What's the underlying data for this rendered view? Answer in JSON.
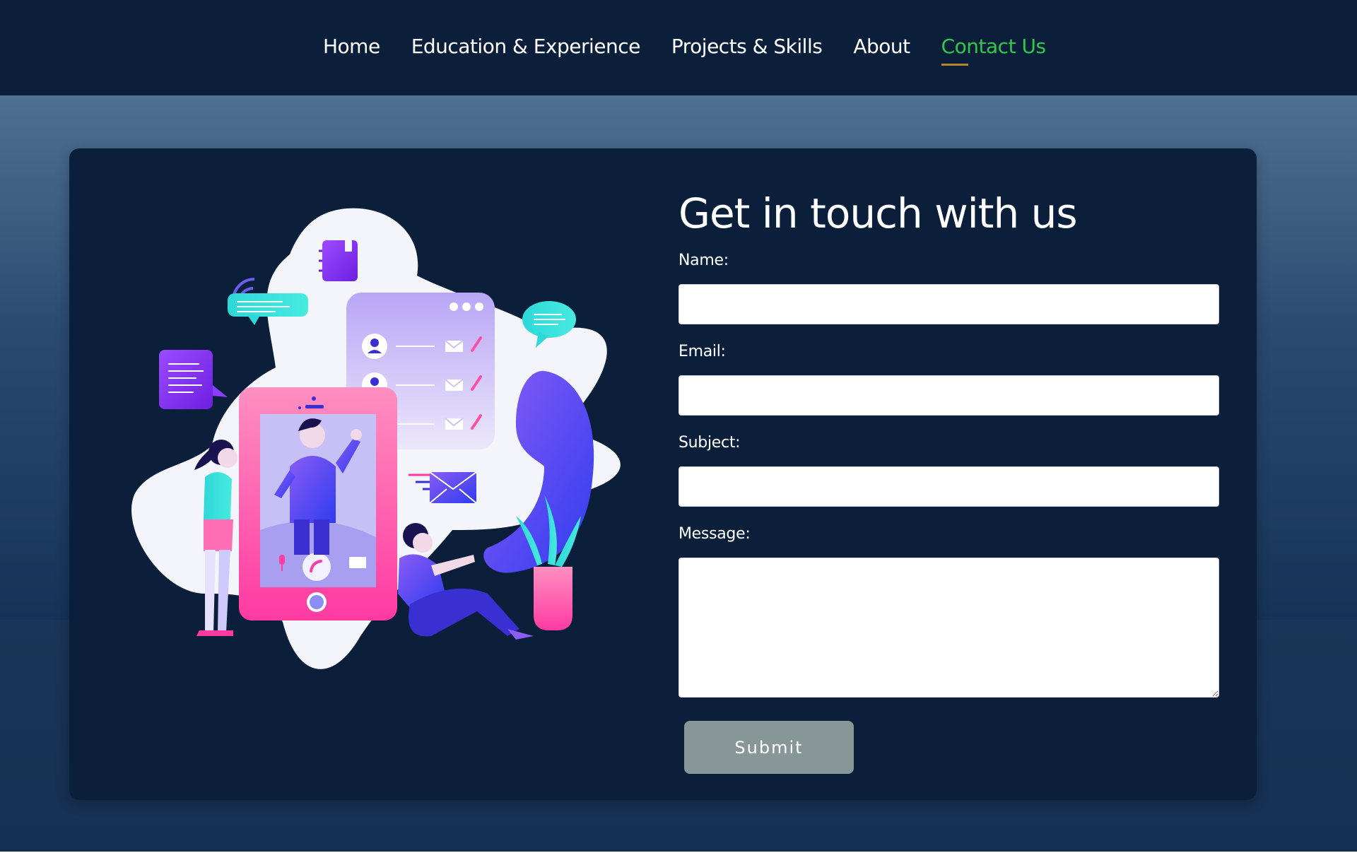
{
  "nav": {
    "items": [
      {
        "label": "Home"
      },
      {
        "label": "Education & Experience"
      },
      {
        "label": "Projects & Skills"
      },
      {
        "label": "About"
      },
      {
        "label": "Contact Us",
        "active": true
      }
    ]
  },
  "contact": {
    "title": "Get in touch with us",
    "fields": {
      "name_label": "Name:",
      "name_value": "",
      "email_label": "Email:",
      "email_value": "",
      "subject_label": "Subject:",
      "subject_value": "",
      "message_label": "Message:",
      "message_value": ""
    },
    "submit_label": "Submit"
  },
  "colors": {
    "nav_bg": "#0b1f3a",
    "active_link": "#2fc94e",
    "active_underline": "#b8862a",
    "card_bg": "#0b1f3a",
    "submit_bg": "#879696"
  },
  "illustration": {
    "icons": [
      "notebook-icon",
      "chat-bubble-icon",
      "contact-list-icon",
      "phone-handset-icon",
      "envelope-icon",
      "smartphone-icon",
      "plant-icon"
    ]
  }
}
